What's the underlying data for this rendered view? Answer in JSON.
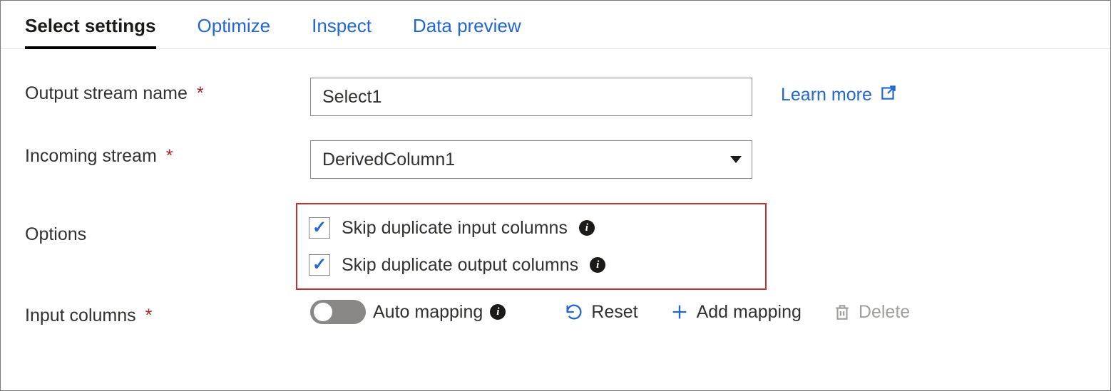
{
  "tabs": [
    {
      "label": "Select settings",
      "active": true
    },
    {
      "label": "Optimize",
      "active": false
    },
    {
      "label": "Inspect",
      "active": false
    },
    {
      "label": "Data preview",
      "active": false
    }
  ],
  "fields": {
    "output_stream_name": {
      "label": "Output stream name",
      "required": true,
      "value": "Select1"
    },
    "incoming_stream": {
      "label": "Incoming stream",
      "required": true,
      "value": "DerivedColumn1"
    },
    "options": {
      "label": "Options",
      "skip_dup_input": {
        "label": "Skip duplicate input columns",
        "checked": true
      },
      "skip_dup_output": {
        "label": "Skip duplicate output columns",
        "checked": true
      }
    },
    "input_columns": {
      "label": "Input columns",
      "required": true,
      "auto_mapping_label": "Auto mapping",
      "auto_mapping_on": false,
      "reset_label": "Reset",
      "add_mapping_label": "Add mapping",
      "delete_label": "Delete"
    }
  },
  "learn_more": "Learn more"
}
